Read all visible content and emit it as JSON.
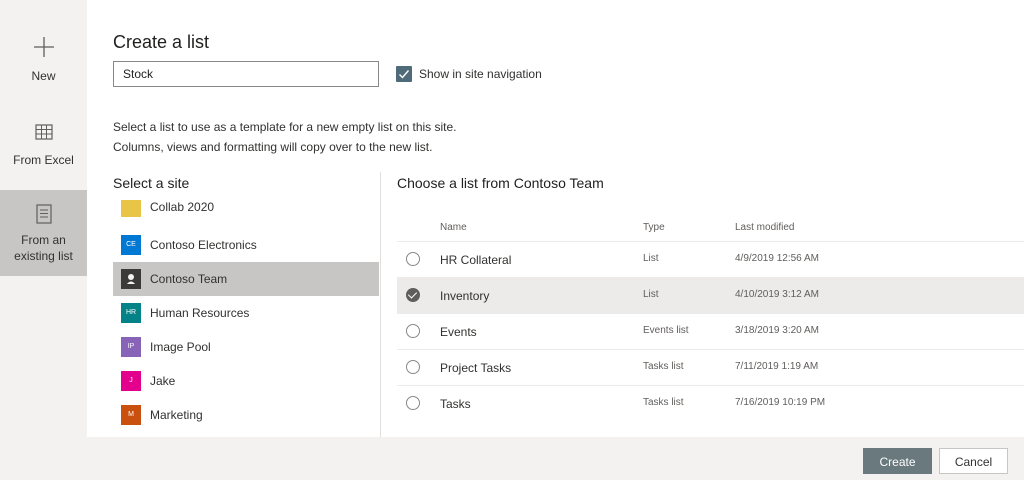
{
  "rail": {
    "new_label": "New",
    "excel_label": "From Excel",
    "existing_label_line1": "From an",
    "existing_label_line2": "existing list"
  },
  "dialog": {
    "title": "Create a list",
    "name_value": "Stock",
    "show_in_nav_label": "Show in site navigation",
    "show_in_nav_checked": true,
    "description_line1": "Select a list to use as a template for a new empty list on this site.",
    "description_line2": "Columns, views and formatting will copy over to the new list."
  },
  "sites": {
    "heading": "Select a site",
    "items": [
      {
        "name": "Collab 2020",
        "initials": "",
        "color": "#e8c547"
      },
      {
        "name": "Contoso Electronics",
        "initials": "CE",
        "color": "#0078d4"
      },
      {
        "name": "Contoso Team",
        "initials": "",
        "color": "#3b3a39",
        "selected": true
      },
      {
        "name": "Human Resources",
        "initials": "HR",
        "color": "#038387"
      },
      {
        "name": "Image Pool",
        "initials": "IP",
        "color": "#8764b8"
      },
      {
        "name": "Jake",
        "initials": "J",
        "color": "#e3008c"
      },
      {
        "name": "Marketing",
        "initials": "M",
        "color": "#ca5010"
      }
    ]
  },
  "lists": {
    "heading": "Choose a list from Contoso Team",
    "columns": {
      "name": "Name",
      "type": "Type",
      "modified": "Last modified"
    },
    "rows": [
      {
        "name": "HR Collateral",
        "type": "List",
        "modified": "4/9/2019 12:56 AM",
        "selected": false
      },
      {
        "name": "Inventory",
        "type": "List",
        "modified": "4/10/2019 3:12 AM",
        "selected": true
      },
      {
        "name": "Events",
        "type": "Events list",
        "modified": "3/18/2019 3:20 AM",
        "selected": false
      },
      {
        "name": "Project Tasks",
        "type": "Tasks list",
        "modified": "7/11/2019 1:19 AM",
        "selected": false
      },
      {
        "name": "Tasks",
        "type": "Tasks list",
        "modified": "7/16/2019 10:19 PM",
        "selected": false
      }
    ]
  },
  "footer": {
    "create_label": "Create",
    "cancel_label": "Cancel"
  },
  "colors": {
    "accent": "#4f6b7a",
    "create_button": "#69797e",
    "selected_row": "#edebe9",
    "selected_site": "#c8c6c4"
  }
}
